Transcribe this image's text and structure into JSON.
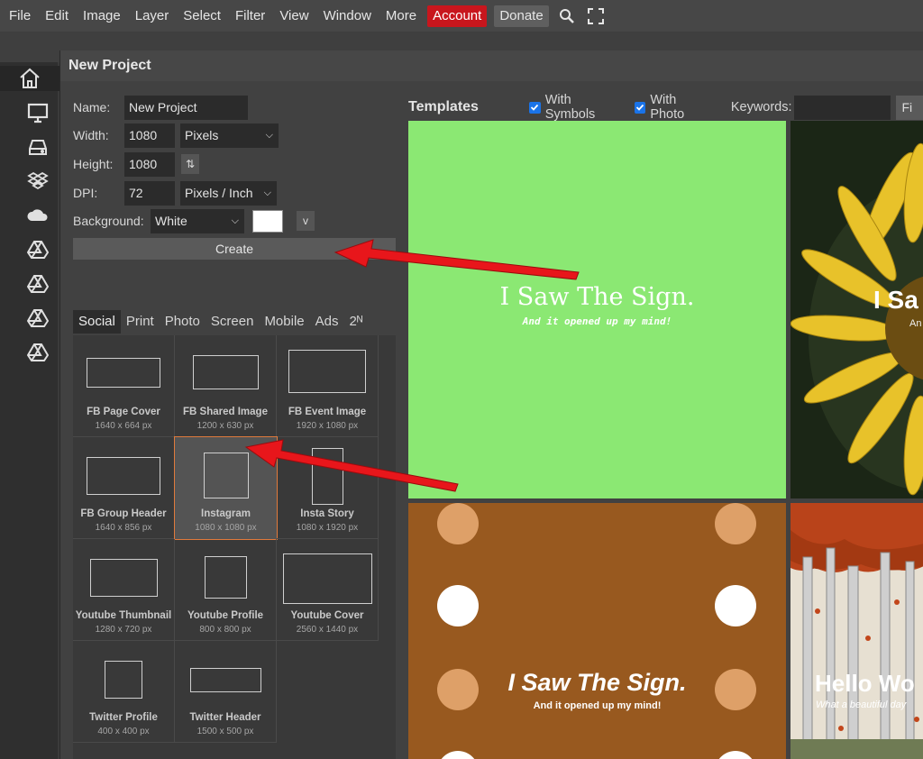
{
  "menu": {
    "items": [
      "File",
      "Edit",
      "Image",
      "Layer",
      "Select",
      "Filter",
      "View",
      "Window",
      "More"
    ],
    "account": "Account",
    "donate": "Donate",
    "search_icon": "search-icon",
    "fullscreen_icon": "fullscreen-icon"
  },
  "sidebar": {
    "icons": [
      "home-icon",
      "monitor-icon",
      "hard-drive-icon",
      "dropbox-icon",
      "onedrive-icon",
      "google-drive-icon",
      "google-drive-icon",
      "google-drive-icon",
      "google-drive-icon"
    ]
  },
  "dialog": {
    "title": "New Project",
    "name_label": "Name:",
    "name_value": "New Project",
    "width_label": "Width:",
    "width_value": "1080",
    "width_unit": "Pixels",
    "height_label": "Height:",
    "height_value": "1080",
    "swap_label": "⇅",
    "dpi_label": "DPI:",
    "dpi_value": "72",
    "dpi_unit": "Pixels / Inch",
    "background_label": "Background:",
    "background_value": "White",
    "background_color": "#ffffff",
    "v_button": "v",
    "create": "Create"
  },
  "tabs": [
    "Social",
    "Print",
    "Photo",
    "Screen",
    "Mobile",
    "Ads",
    "2ᴺ"
  ],
  "active_tab": "Social",
  "presets": [
    {
      "name": "FB Page Cover",
      "size": "1640 x 664 px"
    },
    {
      "name": "FB Shared Image",
      "size": "1200 x 630 px"
    },
    {
      "name": "FB Event Image",
      "size": "1920 x 1080 px"
    },
    {
      "name": "FB Group Header",
      "size": "1640 x 856 px"
    },
    {
      "name": "Instagram",
      "size": "1080 x 1080 px"
    },
    {
      "name": "Insta Story",
      "size": "1080 x 1920 px"
    },
    {
      "name": "Youtube Thumbnail",
      "size": "1280 x 720 px"
    },
    {
      "name": "Youtube Profile",
      "size": "800 x 800 px"
    },
    {
      "name": "Youtube Cover",
      "size": "2560 x 1440 px"
    },
    {
      "name": "Twitter Profile",
      "size": "400 x 400 px"
    },
    {
      "name": "Twitter Header",
      "size": "1500 x 500 px"
    }
  ],
  "selected_preset": "Instagram",
  "templates": {
    "title": "Templates",
    "with_symbols": "With Symbols",
    "with_photo": "With Photo",
    "keywords_label": "Keywords:",
    "keywords_value": "",
    "find_button": "Fi",
    "cards": [
      {
        "main": "I Saw The Sign.",
        "sub": "And it opened up my mind!",
        "bg": "#8be873"
      },
      {
        "main": "I Sa",
        "sub": "An",
        "bg": "#1d2a17"
      },
      {
        "main": "I Saw The Sign.",
        "sub": "And it opened up my mind!",
        "bg": "#98591f"
      },
      {
        "main": "Hello Wo",
        "sub": "What a beautiful day",
        "bg": "#efe8d8"
      }
    ]
  },
  "colors": {
    "accent_red": "#c8161d",
    "selection_orange": "#e07a3c",
    "checkbox_blue": "#1a73e8",
    "arrow_red": "#e8161b"
  }
}
